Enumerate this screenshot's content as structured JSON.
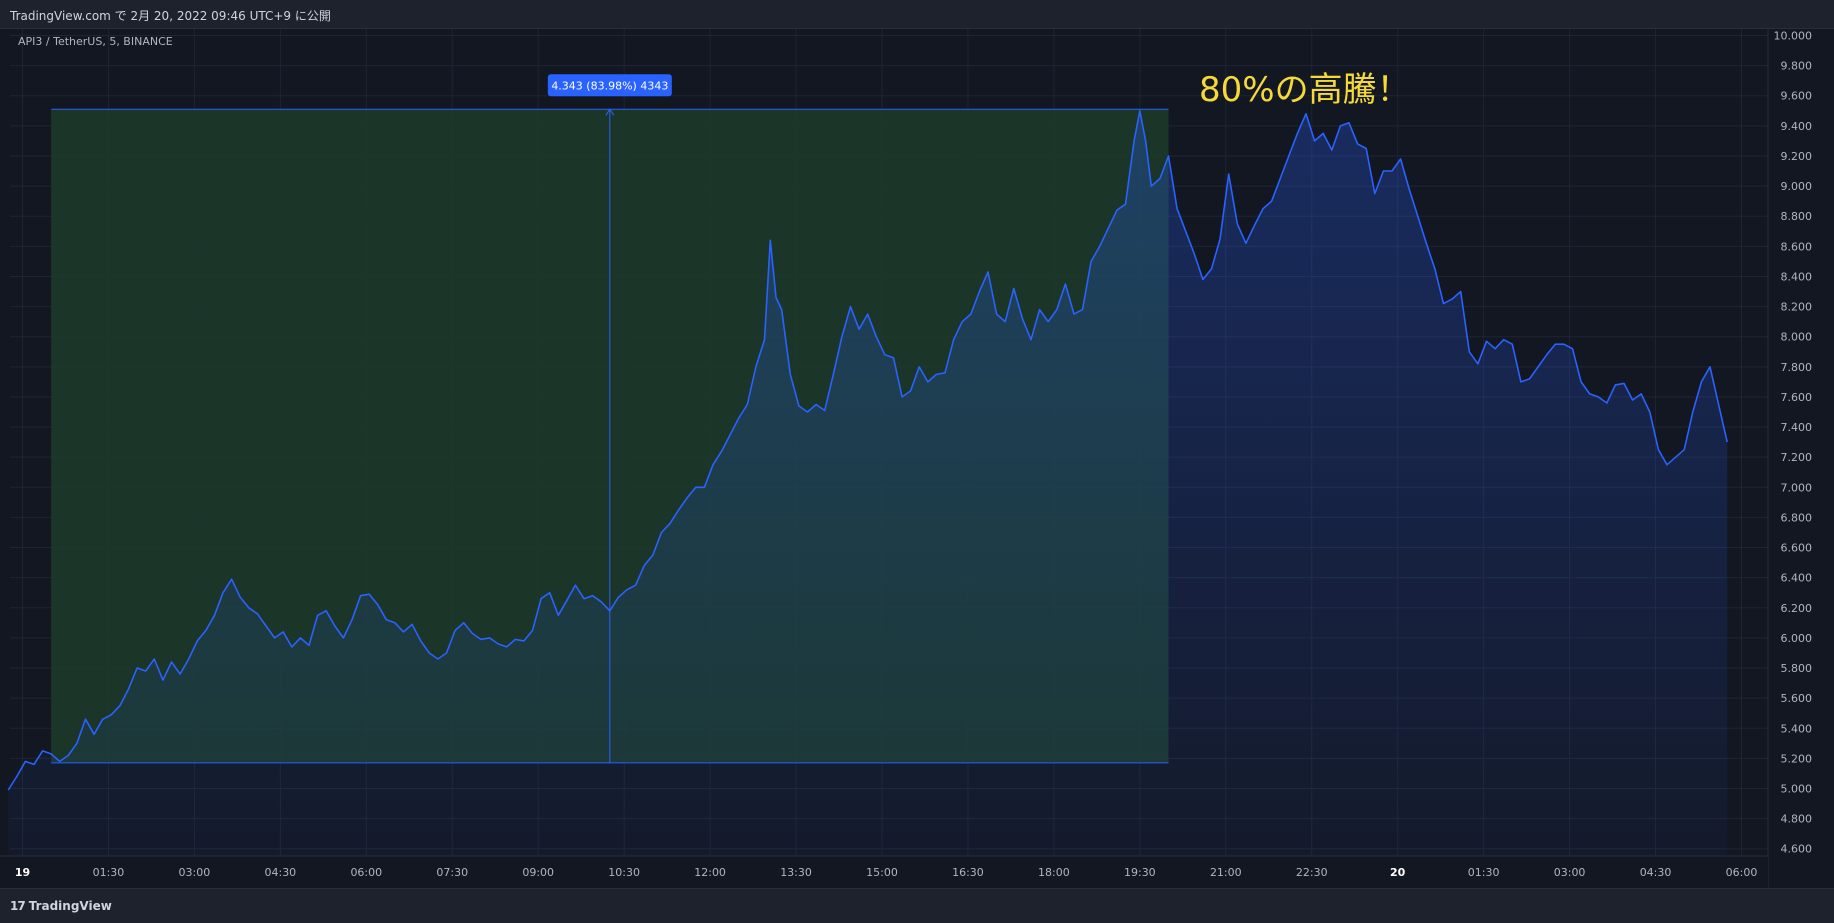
{
  "header": {
    "published": "TradingView.com で 2月 20, 2022 09:46 UTC+9 に公開"
  },
  "footer": {
    "brand": "TradingView",
    "logo_glyph": "17"
  },
  "colors": {
    "line": "#2962ff",
    "measure_fill": "#1d3b2a",
    "background": "#131722",
    "annotation": "#f5d938",
    "label_bg": "#2962ff"
  },
  "chart_data": {
    "type": "area",
    "title": "API3 / TetherUS, 5, BINANCE",
    "annotation": "80%の高騰！",
    "ylim": [
      4.5,
      10.1
    ],
    "yticks": [
      "10.000",
      "9.800",
      "9.600",
      "9.400",
      "9.200",
      "9.000",
      "8.800",
      "8.600",
      "8.400",
      "8.200",
      "8.000",
      "7.800",
      "7.600",
      "7.400",
      "7.200",
      "7.000",
      "6.800",
      "6.600",
      "6.400",
      "6.200",
      "6.000",
      "5.800",
      "5.600",
      "5.400",
      "5.200",
      "5.000",
      "4.800",
      "4.600"
    ],
    "xlim": [
      0,
      60.75
    ],
    "xticks": [
      {
        "t": 0.5,
        "label": "19",
        "bold": true
      },
      {
        "t": 3.5,
        "label": "01:30"
      },
      {
        "t": 6.5,
        "label": "03:00"
      },
      {
        "t": 9.5,
        "label": "04:30"
      },
      {
        "t": 12.5,
        "label": "06:00"
      },
      {
        "t": 15.5,
        "label": "07:30"
      },
      {
        "t": 18.5,
        "label": "09:00"
      },
      {
        "t": 21.5,
        "label": "10:30"
      },
      {
        "t": 24.5,
        "label": "12:00"
      },
      {
        "t": 27.5,
        "label": "13:30"
      },
      {
        "t": 30.5,
        "label": "15:00"
      },
      {
        "t": 33.5,
        "label": "16:30"
      },
      {
        "t": 36.5,
        "label": "18:00"
      },
      {
        "t": 39.5,
        "label": "19:30"
      },
      {
        "t": 42.5,
        "label": "21:00"
      },
      {
        "t": 45.5,
        "label": "22:30"
      },
      {
        "t": 48.5,
        "label": "20",
        "bold": true
      },
      {
        "t": 51.5,
        "label": "01:30"
      },
      {
        "t": 54.5,
        "label": "03:00"
      },
      {
        "t": 57.5,
        "label": "04:30"
      },
      {
        "t": 60.5,
        "label": "06:00"
      }
    ],
    "series": [
      {
        "values": [
          [
            0.0,
            4.99
          ],
          [
            0.3,
            5.08
          ],
          [
            0.6,
            5.18
          ],
          [
            0.9,
            5.16
          ],
          [
            1.2,
            5.25
          ],
          [
            1.5,
            5.23
          ],
          [
            1.8,
            5.18
          ],
          [
            2.1,
            5.22
          ],
          [
            2.4,
            5.3
          ],
          [
            2.7,
            5.46
          ],
          [
            3.0,
            5.36
          ],
          [
            3.3,
            5.46
          ],
          [
            3.6,
            5.49
          ],
          [
            3.9,
            5.55
          ],
          [
            4.2,
            5.66
          ],
          [
            4.5,
            5.8
          ],
          [
            4.8,
            5.78
          ],
          [
            5.1,
            5.86
          ],
          [
            5.4,
            5.72
          ],
          [
            5.7,
            5.84
          ],
          [
            6.0,
            5.76
          ],
          [
            6.3,
            5.86
          ],
          [
            6.6,
            5.98
          ],
          [
            6.9,
            6.05
          ],
          [
            7.2,
            6.15
          ],
          [
            7.5,
            6.3
          ],
          [
            7.8,
            6.39
          ],
          [
            8.1,
            6.27
          ],
          [
            8.4,
            6.2
          ],
          [
            8.7,
            6.16
          ],
          [
            9.0,
            6.08
          ],
          [
            9.3,
            6.0
          ],
          [
            9.6,
            6.04
          ],
          [
            9.9,
            5.94
          ],
          [
            10.2,
            6.0
          ],
          [
            10.5,
            5.95
          ],
          [
            10.8,
            6.15
          ],
          [
            11.1,
            6.18
          ],
          [
            11.4,
            6.08
          ],
          [
            11.7,
            6.0
          ],
          [
            12.0,
            6.12
          ],
          [
            12.3,
            6.28
          ],
          [
            12.6,
            6.29
          ],
          [
            12.9,
            6.22
          ],
          [
            13.2,
            6.12
          ],
          [
            13.5,
            6.1
          ],
          [
            13.8,
            6.04
          ],
          [
            14.1,
            6.09
          ],
          [
            14.4,
            5.98
          ],
          [
            14.7,
            5.9
          ],
          [
            15.0,
            5.86
          ],
          [
            15.3,
            5.9
          ],
          [
            15.6,
            6.05
          ],
          [
            15.9,
            6.1
          ],
          [
            16.2,
            6.03
          ],
          [
            16.5,
            5.99
          ],
          [
            16.8,
            6.0
          ],
          [
            17.1,
            5.96
          ],
          [
            17.4,
            5.94
          ],
          [
            17.7,
            5.99
          ],
          [
            18.0,
            5.98
          ],
          [
            18.3,
            6.05
          ],
          [
            18.6,
            6.26
          ],
          [
            18.9,
            6.3
          ],
          [
            19.2,
            6.15
          ],
          [
            19.5,
            6.25
          ],
          [
            19.8,
            6.35
          ],
          [
            20.1,
            6.26
          ],
          [
            20.4,
            6.28
          ],
          [
            20.7,
            6.24
          ],
          [
            21.0,
            6.18
          ],
          [
            21.3,
            6.27
          ],
          [
            21.6,
            6.32
          ],
          [
            21.9,
            6.35
          ],
          [
            22.2,
            6.48
          ],
          [
            22.5,
            6.55
          ],
          [
            22.8,
            6.7
          ],
          [
            23.1,
            6.76
          ],
          [
            23.4,
            6.85
          ],
          [
            23.7,
            6.93
          ],
          [
            24.0,
            7.0
          ],
          [
            24.3,
            7.0
          ],
          [
            24.6,
            7.15
          ],
          [
            24.9,
            7.24
          ],
          [
            25.2,
            7.35
          ],
          [
            25.5,
            7.46
          ],
          [
            25.8,
            7.55
          ],
          [
            26.1,
            7.8
          ],
          [
            26.4,
            7.98
          ],
          [
            26.6,
            8.64
          ],
          [
            26.8,
            8.26
          ],
          [
            27.0,
            8.18
          ],
          [
            27.3,
            7.75
          ],
          [
            27.6,
            7.54
          ],
          [
            27.9,
            7.5
          ],
          [
            28.2,
            7.55
          ],
          [
            28.5,
            7.51
          ],
          [
            28.8,
            7.75
          ],
          [
            29.1,
            8.0
          ],
          [
            29.4,
            8.2
          ],
          [
            29.7,
            8.05
          ],
          [
            30.0,
            8.15
          ],
          [
            30.3,
            8.0
          ],
          [
            30.6,
            7.88
          ],
          [
            30.9,
            7.86
          ],
          [
            31.2,
            7.6
          ],
          [
            31.5,
            7.64
          ],
          [
            31.8,
            7.8
          ],
          [
            32.1,
            7.7
          ],
          [
            32.4,
            7.75
          ],
          [
            32.7,
            7.76
          ],
          [
            33.0,
            7.98
          ],
          [
            33.3,
            8.1
          ],
          [
            33.6,
            8.15
          ],
          [
            33.9,
            8.3
          ],
          [
            34.2,
            8.43
          ],
          [
            34.5,
            8.15
          ],
          [
            34.8,
            8.1
          ],
          [
            35.1,
            8.32
          ],
          [
            35.4,
            8.12
          ],
          [
            35.7,
            7.98
          ],
          [
            36.0,
            8.18
          ],
          [
            36.3,
            8.1
          ],
          [
            36.6,
            8.18
          ],
          [
            36.9,
            8.35
          ],
          [
            37.2,
            8.15
          ],
          [
            37.5,
            8.18
          ],
          [
            37.8,
            8.5
          ],
          [
            38.1,
            8.6
          ],
          [
            38.4,
            8.72
          ],
          [
            38.7,
            8.84
          ],
          [
            39.0,
            8.88
          ],
          [
            39.3,
            9.3
          ],
          [
            39.5,
            9.5
          ],
          [
            39.7,
            9.3
          ],
          [
            39.9,
            9.0
          ],
          [
            40.2,
            9.05
          ],
          [
            40.5,
            9.2
          ],
          [
            40.8,
            8.85
          ],
          [
            41.1,
            8.7
          ],
          [
            41.4,
            8.55
          ],
          [
            41.7,
            8.38
          ],
          [
            42.0,
            8.45
          ],
          [
            42.3,
            8.65
          ],
          [
            42.6,
            9.08
          ],
          [
            42.9,
            8.75
          ],
          [
            43.2,
            8.62
          ],
          [
            43.5,
            8.74
          ],
          [
            43.8,
            8.85
          ],
          [
            44.1,
            8.9
          ],
          [
            44.4,
            9.05
          ],
          [
            44.7,
            9.2
          ],
          [
            45.0,
            9.35
          ],
          [
            45.3,
            9.48
          ],
          [
            45.6,
            9.3
          ],
          [
            45.9,
            9.35
          ],
          [
            46.2,
            9.24
          ],
          [
            46.5,
            9.4
          ],
          [
            46.8,
            9.42
          ],
          [
            47.1,
            9.28
          ],
          [
            47.4,
            9.25
          ],
          [
            47.7,
            8.95
          ],
          [
            48.0,
            9.1
          ],
          [
            48.3,
            9.1
          ],
          [
            48.6,
            9.18
          ],
          [
            48.9,
            8.98
          ],
          [
            49.2,
            8.8
          ],
          [
            49.5,
            8.62
          ],
          [
            49.8,
            8.45
          ],
          [
            50.1,
            8.22
          ],
          [
            50.4,
            8.25
          ],
          [
            50.7,
            8.3
          ],
          [
            51.0,
            7.9
          ],
          [
            51.3,
            7.82
          ],
          [
            51.6,
            7.97
          ],
          [
            51.9,
            7.92
          ],
          [
            52.2,
            7.98
          ],
          [
            52.5,
            7.95
          ],
          [
            52.8,
            7.7
          ],
          [
            53.1,
            7.72
          ],
          [
            53.4,
            7.8
          ],
          [
            53.7,
            7.88
          ],
          [
            54.0,
            7.95
          ],
          [
            54.3,
            7.95
          ],
          [
            54.6,
            7.92
          ],
          [
            54.9,
            7.7
          ],
          [
            55.2,
            7.62
          ],
          [
            55.5,
            7.6
          ],
          [
            55.8,
            7.56
          ],
          [
            56.1,
            7.68
          ],
          [
            56.4,
            7.69
          ],
          [
            56.7,
            7.58
          ],
          [
            57.0,
            7.62
          ],
          [
            57.3,
            7.5
          ],
          [
            57.6,
            7.25
          ],
          [
            57.9,
            7.15
          ],
          [
            58.2,
            7.2
          ],
          [
            58.5,
            7.25
          ],
          [
            58.8,
            7.5
          ],
          [
            59.1,
            7.7
          ],
          [
            59.4,
            7.8
          ],
          [
            59.7,
            7.55
          ],
          [
            60.0,
            7.3
          ]
        ]
      }
    ],
    "measure": {
      "start_t": 1.5,
      "end_t": 40.5,
      "low": 5.17,
      "high": 9.51,
      "cursor_t": 21.0,
      "label": "4.343 (83.98%) 4343"
    },
    "grid": true
  }
}
